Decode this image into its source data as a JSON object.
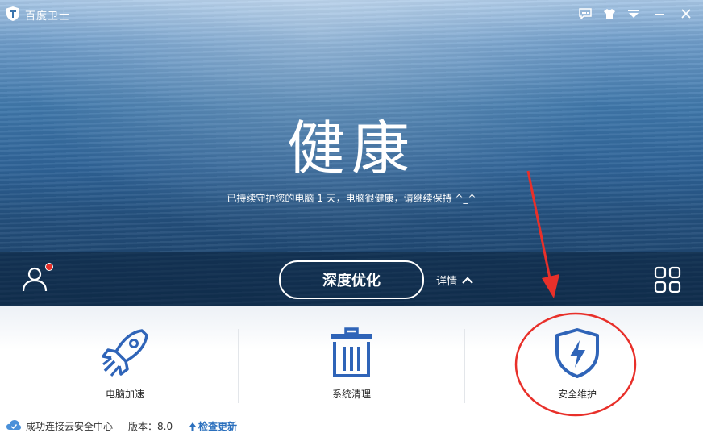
{
  "window": {
    "title": "百度卫士"
  },
  "titlebar_icons": [
    "feedback-icon",
    "skin-icon",
    "menu-icon",
    "minimize-icon",
    "close-icon"
  ],
  "status": {
    "headline": "健康",
    "message": "已持续守护您的电脑 1 天，电脑很健康，请继续保持 ^_^"
  },
  "actionbar": {
    "deep_optimize_label": "深度优化",
    "details_label": "详情",
    "notification_dot": true
  },
  "tools": [
    {
      "label": "电脑加速",
      "icon": "rocket-icon"
    },
    {
      "label": "系统清理",
      "icon": "trash-icon"
    },
    {
      "label": "安全维护",
      "icon": "shield-lightning-icon"
    }
  ],
  "footer": {
    "connection_status": "成功连接云安全中心",
    "version_text": "版本：8.0",
    "update_label": "检查更新"
  },
  "colors": {
    "accent": "#2a6fbd",
    "icon_blue": "#2f64b8",
    "annotation_red": "#e8302a"
  }
}
